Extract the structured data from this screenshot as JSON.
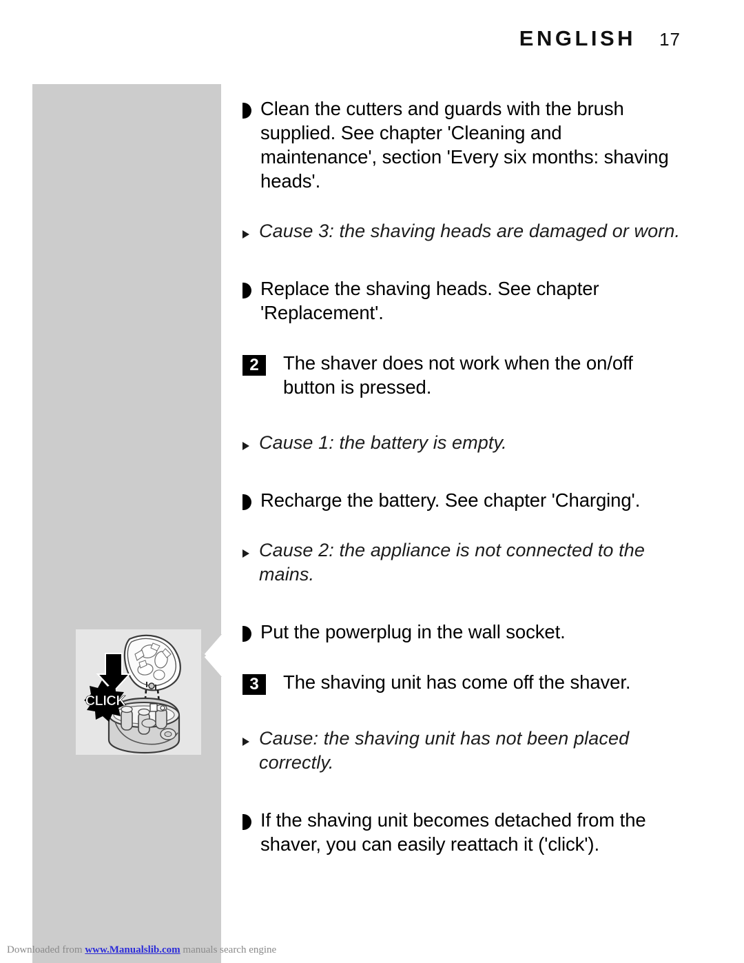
{
  "header": {
    "chapter_title": "ENGLISH",
    "page_number": "17"
  },
  "illustration": {
    "panel_name": "shaving-unit-click-illustration",
    "arrow_label": "down-arrow",
    "burst_label": "CLICK",
    "background_color": "#e6e6e6",
    "column_color": "#cccccc"
  },
  "content": {
    "blocks": [
      {
        "type": "action",
        "text": "Clean the cutters and guards with the brush supplied. See chapter 'Cleaning and maintenance', section 'Every six months: shaving heads'."
      },
      {
        "type": "cause",
        "text": "Cause 3: the shaving heads are damaged or worn."
      },
      {
        "type": "action",
        "text": "Replace the shaving heads. See chapter 'Replacement'."
      },
      {
        "type": "numbered",
        "number": "2",
        "text": "The shaver does not work when the on/off button is pressed."
      },
      {
        "type": "cause",
        "text": "Cause  1: the battery is empty."
      },
      {
        "type": "action",
        "text": "Recharge the battery. See chapter 'Charging'."
      },
      {
        "type": "cause",
        "text": "Cause 2: the appliance is not connected to the mains."
      },
      {
        "type": "action",
        "text": "Put the powerplug in the wall socket."
      },
      {
        "type": "numbered",
        "number": "3",
        "text": "The shaving unit has come off the shaver."
      },
      {
        "type": "cause",
        "text": "Cause: the shaving unit has not been placed correctly."
      },
      {
        "type": "action",
        "text": "If the shaving unit becomes detached from the shaver, you can easily reattach it ('click')."
      }
    ]
  },
  "footer": {
    "prefix": "Downloaded from ",
    "link": "www.Manualslib.com",
    "suffix": " manuals search engine"
  }
}
